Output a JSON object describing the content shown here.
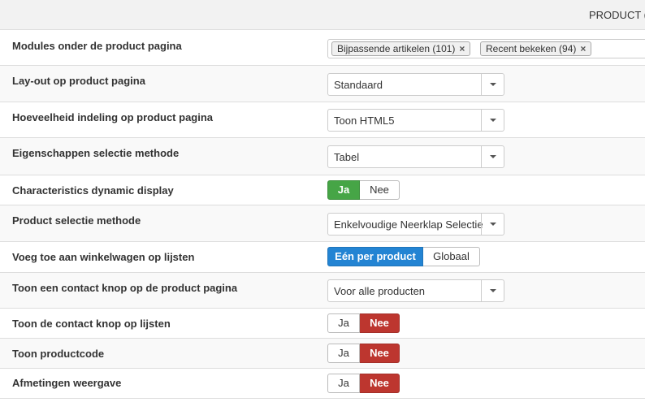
{
  "header": {
    "title": "PRODUCT ("
  },
  "colors": {
    "green": "#46a546",
    "red": "#bd362f",
    "blue": "#2384d3"
  },
  "rows": {
    "modules": {
      "label": "Modules onder de product pagina",
      "tags": [
        "Bijpassende artikelen (101)",
        "Recent bekeken (94)"
      ],
      "remove_glyph": "×"
    },
    "layout": {
      "label": "Lay-out op product pagina",
      "value": "Standaard"
    },
    "quantity": {
      "label": "Hoeveelheid indeling op product pagina",
      "value": "Toon HTML5"
    },
    "properties": {
      "label": "Eigenschappen selectie methode",
      "value": "Tabel"
    },
    "char_dynamic": {
      "label": "Characteristics dynamic display",
      "on": "Ja",
      "off": "Nee",
      "selected": "Ja"
    },
    "product_select": {
      "label": "Product selectie methode",
      "value": "Enkelvoudige Neerklap Selectie"
    },
    "add_to_cart": {
      "label": "Voeg toe aan winkelwagen op lijsten",
      "on": "Eén per product",
      "off": "Globaal",
      "selected": "Eén per product"
    },
    "contact_button": {
      "label": "Toon een contact knop op de product pagina",
      "value": "Voor alle producten"
    },
    "contact_lists": {
      "label": "Toon de contact knop op lijsten",
      "on": "Ja",
      "off": "Nee",
      "selected": "Nee"
    },
    "product_code": {
      "label": "Toon productcode",
      "on": "Ja",
      "off": "Nee",
      "selected": "Nee"
    },
    "dimensions": {
      "label": "Afmetingen weergave",
      "on": "Ja",
      "off": "Nee",
      "selected": "Nee"
    }
  }
}
